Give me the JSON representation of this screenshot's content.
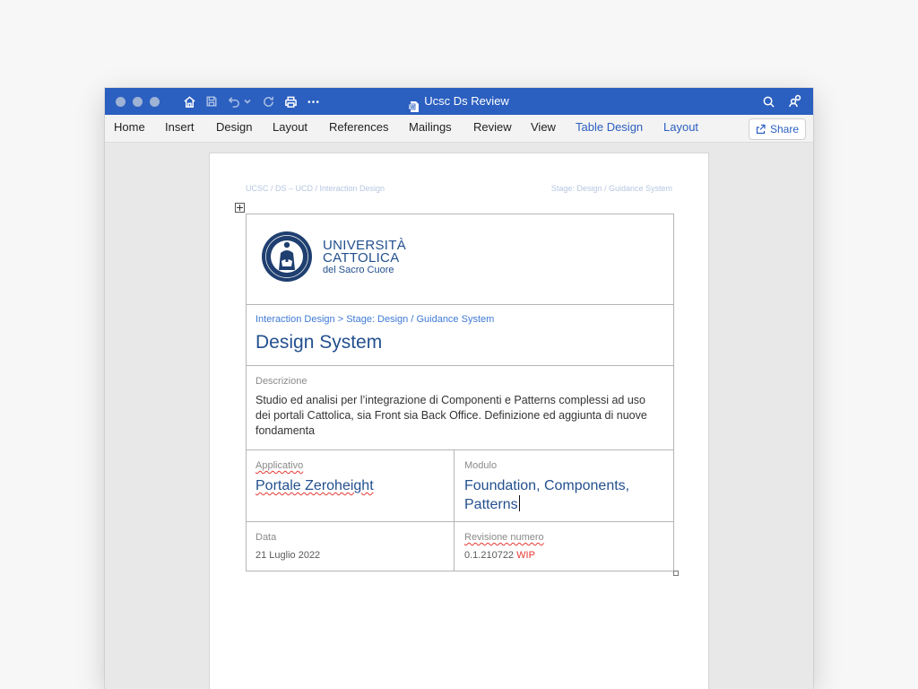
{
  "window": {
    "title": "Ucsc Ds Review"
  },
  "ribbon": {
    "tabs": [
      "Home",
      "Insert",
      "Design",
      "Layout",
      "References",
      "Mailings",
      "Review",
      "View",
      "Table Design",
      "Layout"
    ],
    "share_label": "Share"
  },
  "icons": [
    "home-icon",
    "save-icon",
    "undo-icon",
    "redo-icon",
    "print-icon",
    "more-icon",
    "word-doc-icon",
    "search-icon",
    "account-icon",
    "share-icon"
  ],
  "document": {
    "header_left": "UCSC / DS – UCD / Interaction Design",
    "header_right": "Stage: Design / Guidance System",
    "logo": {
      "line1": "UNIVERSITÀ",
      "line2": "CATTOLICA",
      "line3": "del Sacro Cuore"
    },
    "breadcrumb": "Interaction Design > Stage: Design / Guidance System",
    "title": "Design System",
    "description_label": "Descrizione",
    "description_text": "Studio ed analisi per l’integrazione di Componenti e Patterns complessi ad uso dei portali Cattolica, sia Front sia Back Office. Definizione ed aggiunta di nuove fondamenta",
    "applicativo_label": "Applicativo",
    "applicativo_value": "Portale Zeroheight",
    "modulo_label": "Modulo",
    "modulo_value_line1": "Foundation, Components,",
    "modulo_value_line2": "Patterns",
    "data_label": "Data",
    "data_value": "21 Luglio 2022",
    "revisione_label": "Revisione numero",
    "revisione_value": "0.1.210722",
    "revisione_status": "WIP"
  },
  "colors": {
    "titlebar": "#2b5fc0",
    "heading": "#23508f",
    "link": "#3e7ad6",
    "wip": "#e53935"
  }
}
